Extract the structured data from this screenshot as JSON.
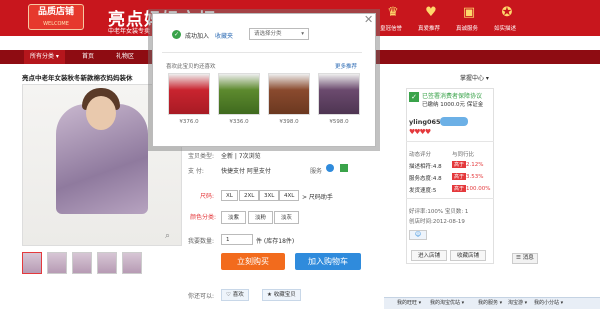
{
  "header": {
    "logo_line1": "品质店铺",
    "logo_line2": "WELCOME",
    "title": "亮点妈妈衣柜",
    "subtitle": "中老年女装专卖",
    "icons": [
      {
        "name": "crown-icon",
        "glyph": "♛",
        "label": "皇冠信誉"
      },
      {
        "name": "heart-icon",
        "glyph": "♥",
        "label": "真爱推荐"
      },
      {
        "name": "gift-icon",
        "glyph": "▣",
        "label": "真诚服务"
      },
      {
        "name": "badge-icon",
        "glyph": "✪",
        "label": "如实描述"
      }
    ]
  },
  "nav": {
    "items": [
      "所有分类 ▾",
      "首页",
      "礼物区"
    ]
  },
  "product": {
    "title": "亮点中老年女装秋冬新款棉衣妈妈装休",
    "props": {
      "type_label": "宝贝类型:",
      "type_value": "全新 | 7次浏览",
      "pay_label": "支  付:",
      "pay_value": "快捷支付  阿里支付",
      "service_label": "服务",
      "size_label": "尺码:",
      "sizes": [
        "XL",
        "2XL",
        "3XL",
        "4XL"
      ],
      "size_help": "> 尺码助手",
      "color_label": "颜色分类:",
      "colors": [
        "淡紫",
        "淡粉",
        "淡灰"
      ],
      "qty_label": "我要数量:",
      "qty_value": "1",
      "stock": "件 (库存18件)"
    },
    "buy_label": "立刻购买",
    "cart_label": "加入购物车",
    "share_label": "你还可以:",
    "like_label": "喜欢",
    "fav_label": "收藏宝贝"
  },
  "shop": {
    "top_link": "掌握中心 ▾",
    "protect_title": "已签署消费者保障协议",
    "protect_sub": "已缴纳 1000.0元 保证金",
    "seller": "yling065",
    "dsr_title": "动态评分",
    "dsr_compare": "与同行比",
    "ratings": [
      {
        "label": "描述相符:4.8",
        "tag": "高于",
        "pct": "2.12%"
      },
      {
        "label": "服务态度:4.8",
        "tag": "高于",
        "pct": "3.53%"
      },
      {
        "label": "发货速度:5",
        "tag": "高于",
        "pct": "100.00%"
      }
    ],
    "good_rate": "好评率:100%  宝贝数: 1",
    "created": "创店时间:2012-08-19",
    "enter_shop": "进入店铺",
    "fav_shop": "收藏店铺"
  },
  "popup": {
    "success": "成功加入",
    "fav_link": "收藏夹",
    "select_placeholder": "请选择分类",
    "recommend_title": "喜欢此宝贝的还喜欢",
    "more_link": "更多推荐",
    "items": [
      {
        "price": "¥376.0",
        "color": "#c9242f"
      },
      {
        "price": "¥336.0",
        "color": "#5d8a2e"
      },
      {
        "price": "¥398.0",
        "color": "#8a4a2e"
      },
      {
        "price": "¥598.0",
        "color": "#6b4a6e"
      }
    ]
  },
  "bottom": {
    "items": [
      "我的旺旺 ▾",
      "我的淘宝优站 ▾",
      "我的服务 ▾",
      "淘宝游 ▾",
      "我的小分站 ▾"
    ],
    "msg_label": "消息"
  },
  "colors": {
    "brand_red": "#c8161d",
    "buy_orange": "#f26b1d",
    "cart_blue": "#2f8bdc"
  }
}
